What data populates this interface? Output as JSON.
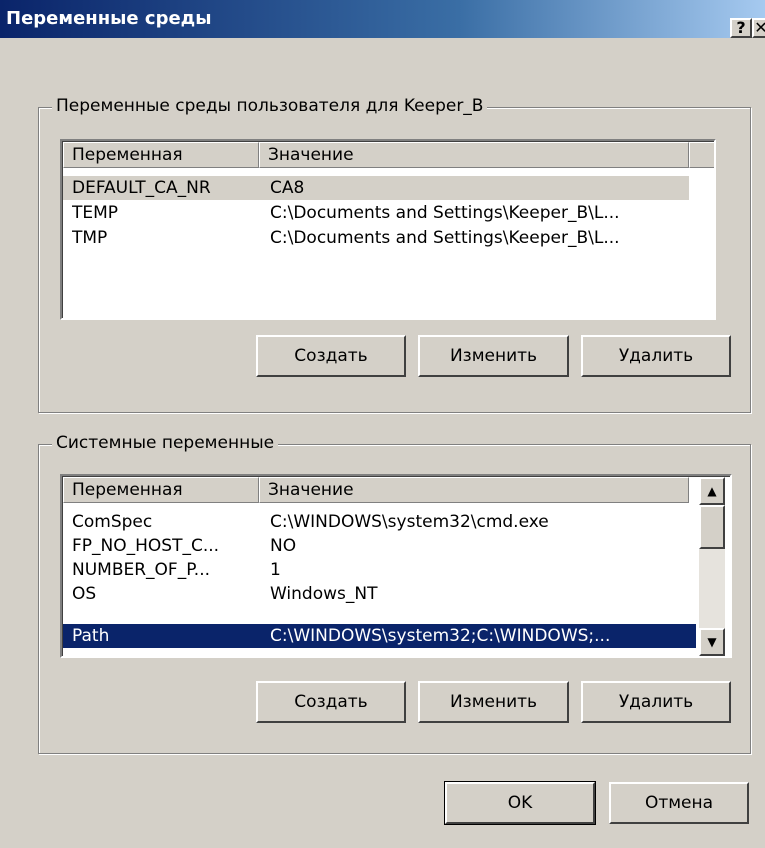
{
  "window": {
    "title": "Переменные среды",
    "help_label": "?",
    "close_label": "✕"
  },
  "user_vars": {
    "group_label": "Переменные среды пользователя для Keeper_B",
    "columns": [
      "Переменная",
      "Значение"
    ],
    "rows": [
      [
        "DEFAULT_CA_NR",
        "CA8"
      ],
      [
        "TEMP",
        "C:\\Documents and Settings\\Keeper_B\\L..."
      ],
      [
        "TMP",
        "C:\\Documents and Settings\\Keeper_B\\L..."
      ]
    ],
    "buttons": {
      "create": "Создать",
      "edit": "Изменить",
      "delete": "Удалить"
    }
  },
  "system_vars": {
    "group_label": "Системные переменные",
    "columns": [
      "Переменная",
      "Значение"
    ],
    "rows": [
      [
        "ComSpec",
        "C:\\WINDOWS\\system32\\cmd.exe"
      ],
      [
        "FP_NO_HOST_C...",
        "NO"
      ],
      [
        "NUMBER_OF_P...",
        "1"
      ],
      [
        "OS",
        "Windows_NT"
      ],
      [
        "Path",
        "C:\\WINDOWS\\system32;C:\\WINDOWS;..."
      ]
    ],
    "buttons": {
      "create": "Создать",
      "edit": "Изменить",
      "delete": "Удалить"
    },
    "scroll_up": "▲",
    "scroll_down": "▼"
  },
  "footer": {
    "ok": "OK",
    "cancel": "Отмена"
  }
}
